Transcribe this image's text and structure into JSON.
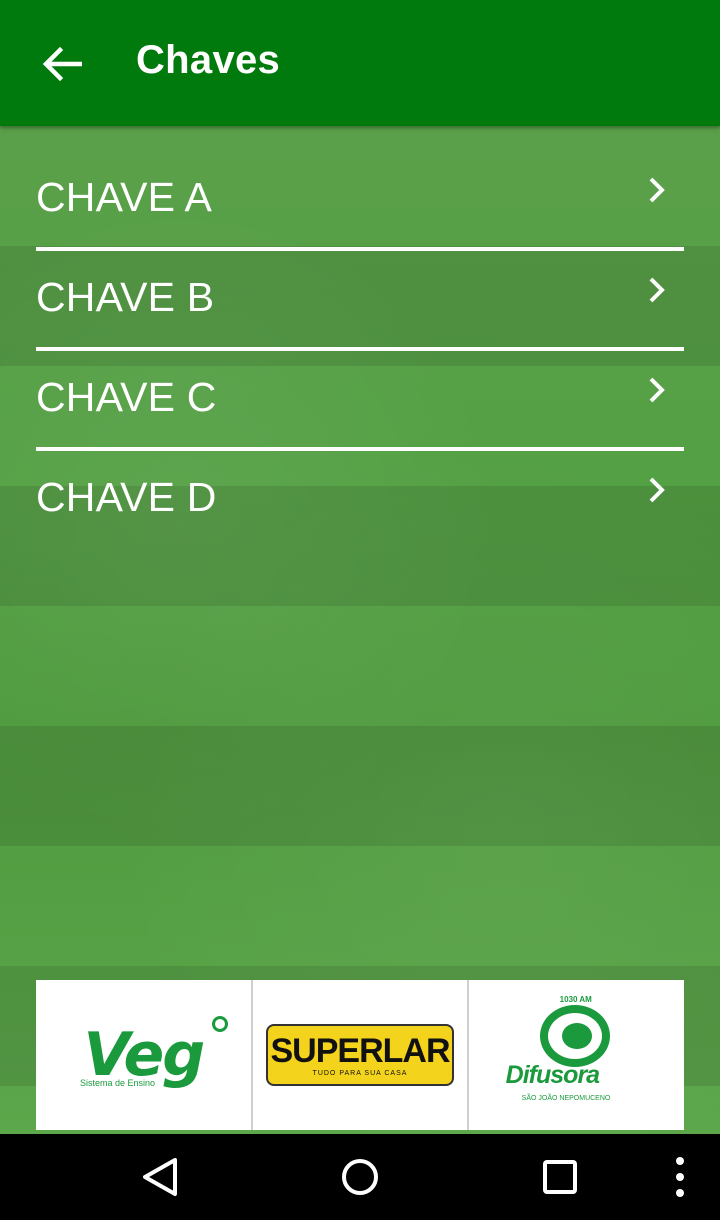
{
  "appbar": {
    "title": "Chaves",
    "back_icon": "arrow-left-icon"
  },
  "list": {
    "items": [
      {
        "label": "CHAVE A",
        "icon": "chevron-right-icon"
      },
      {
        "label": "CHAVE B",
        "icon": "chevron-right-icon"
      },
      {
        "label": "CHAVE C",
        "icon": "chevron-right-icon"
      },
      {
        "label": "CHAVE D",
        "icon": "chevron-right-icon"
      }
    ]
  },
  "sponsors": {
    "veg": {
      "name": "Veg",
      "tagline": "Sistema de Ensino"
    },
    "superlar": {
      "name": "SUPERLAR",
      "tagline": "TUDO PARA SUA CASA"
    },
    "difusora": {
      "name": "Difusora",
      "frequency": "1030 AM",
      "city": "SÃO JOÃO NEPOMUCENO"
    }
  },
  "navbar": {
    "back_icon": "triangle-back-icon",
    "home_icon": "circle-home-icon",
    "recents_icon": "square-recents-icon",
    "menu_icon": "vertical-dots-icon"
  },
  "colors": {
    "appbar": "#007a0c",
    "background": "#54a044",
    "text": "#ffffff",
    "sponsor_green": "#1a9a3c",
    "superlar_yellow": "#f3d31c"
  }
}
